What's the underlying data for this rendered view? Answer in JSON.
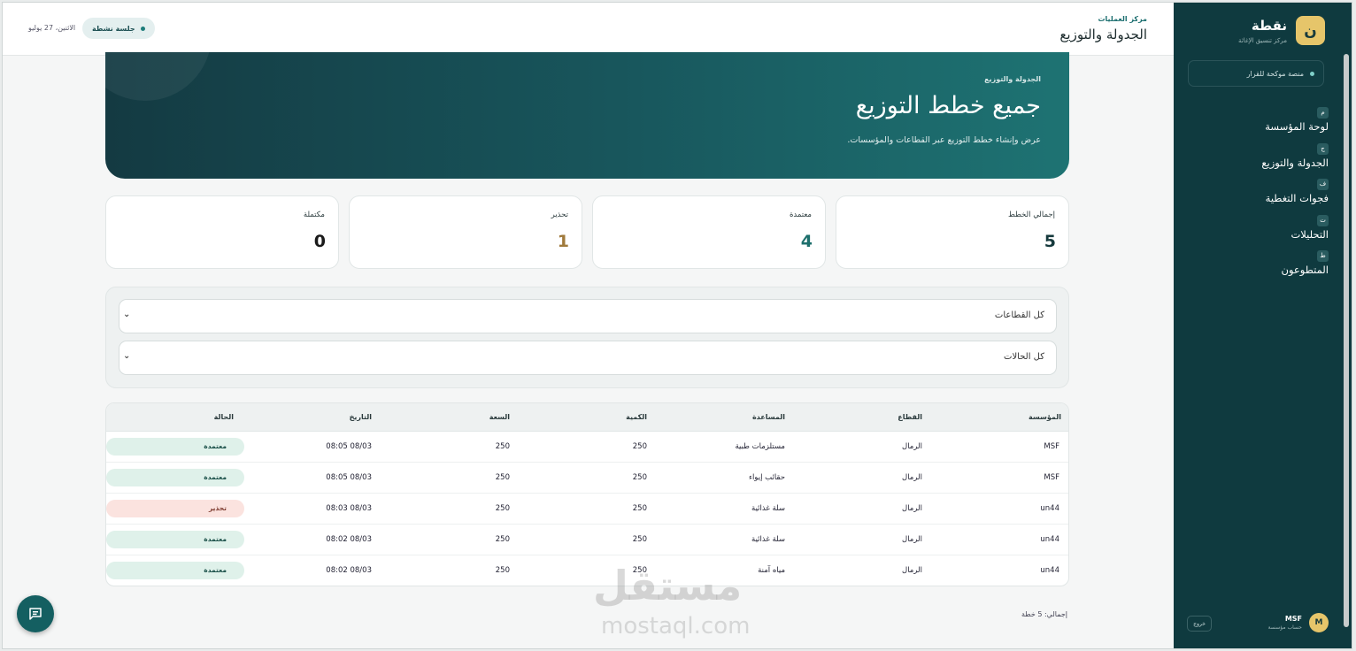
{
  "sidebar": {
    "brand_logo": "ن",
    "brand_name": "نقطة",
    "brand_sub": "مركز تنسيق الإغاثة",
    "platform_tag": "منصة موكحة للقرار",
    "nav": [
      {
        "badge": "م",
        "label": "لوحة المؤسسة",
        "icon": "dashboard-icon"
      },
      {
        "badge": "ج",
        "label": "الجدولة والتوزيع",
        "icon": "schedule-icon"
      },
      {
        "badge": "ف",
        "label": "فجوات التغطية",
        "icon": "gaps-icon"
      },
      {
        "badge": "ت",
        "label": "التحليلات",
        "icon": "analytics-icon"
      },
      {
        "badge": "ط",
        "label": "المتطوعون",
        "icon": "volunteers-icon"
      }
    ],
    "user": {
      "avatar": "M",
      "name": "MSF",
      "role": "حساب مؤسسة"
    },
    "logout": "خروج"
  },
  "header": {
    "sub": "مركز العمليات",
    "title": "الجدولة والتوزيع",
    "session": "جلسة نشطة",
    "date": "الاثنين، 27 يوليو"
  },
  "hero": {
    "kicker": "الجدولة والتوزيع",
    "title": "جميع خطط التوزيع",
    "desc": "عرض وإنشاء خطط التوزيع عبر القطاعات والمؤسسات."
  },
  "stats": [
    {
      "label": "إجمالي الخطط",
      "value": "5",
      "color": "#163a3d"
    },
    {
      "label": "معتمدة",
      "value": "4",
      "color": "#1d6f6c"
    },
    {
      "label": "تحذير",
      "value": "1",
      "color": "#a07a3c"
    },
    {
      "label": "مكتملة",
      "value": "0",
      "color": "#1a1a1a"
    }
  ],
  "filters": {
    "sector": "كل القطاعات",
    "status": "كل الحالات"
  },
  "table": {
    "headers": [
      "المؤسسة",
      "القطاع",
      "المساعدة",
      "الكمية",
      "السعة",
      "التاريخ",
      "الحالة"
    ],
    "rows": [
      [
        "MSF",
        "الرمال",
        "مستلزمات طبية",
        "250",
        "250",
        "08:05 08/03",
        "معتمدة",
        "ok"
      ],
      [
        "MSF",
        "الرمال",
        "حقائب إيواء",
        "250",
        "250",
        "08:05 08/03",
        "معتمدة",
        "ok"
      ],
      [
        "un44",
        "الرمال",
        "سلة غذائية",
        "250",
        "250",
        "08:03 08/03",
        "تحذير",
        "warn"
      ],
      [
        "un44",
        "الرمال",
        "سلة غذائية",
        "250",
        "250",
        "08:02 08/03",
        "معتمدة",
        "ok"
      ],
      [
        "un44",
        "الرمال",
        "مياه آمنة",
        "250",
        "250",
        "08:02 08/03",
        "معتمدة",
        "ok"
      ]
    ]
  },
  "total": "إجمالي: 5 خطة",
  "watermark": {
    "line1": "مستقل",
    "line2": "mostaql.com"
  }
}
